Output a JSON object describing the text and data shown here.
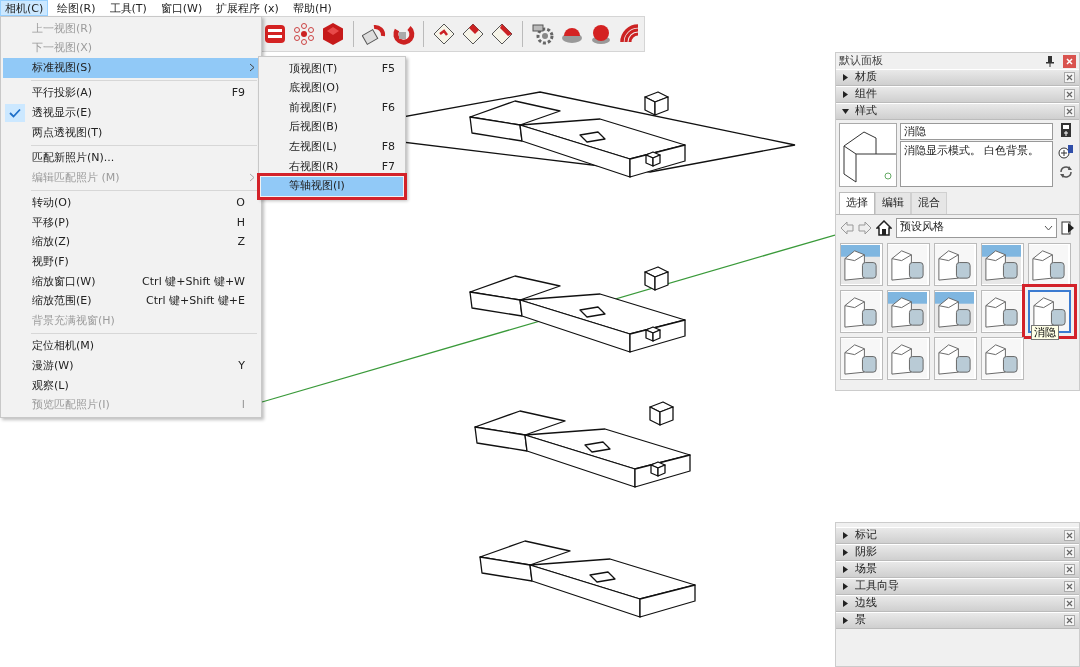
{
  "menubar": [
    {
      "label": "相机(C)",
      "selected": true
    },
    {
      "label": "绘图(R)",
      "selected": false
    },
    {
      "label": "工具(T)",
      "selected": false
    },
    {
      "label": "窗口(W)",
      "selected": false
    },
    {
      "label": "扩展程序 (x)",
      "selected": false
    },
    {
      "label": "帮助(H)",
      "selected": false
    }
  ],
  "camera_menu": {
    "groups": [
      [
        {
          "label": "上一视图(R)",
          "disabled": true,
          "checked": false,
          "selected": false,
          "submenu": false
        },
        {
          "label": "下一视图(X)",
          "disabled": true,
          "checked": false,
          "selected": false,
          "submenu": false
        },
        {
          "label": "标准视图(S)",
          "disabled": false,
          "checked": false,
          "selected": true,
          "submenu": true
        }
      ],
      [
        {
          "label": "平行投影(A)",
          "shortcut": "F9",
          "disabled": false,
          "checked": false,
          "selected": false,
          "submenu": false
        },
        {
          "label": "透视显示(E)",
          "disabled": false,
          "checked": true,
          "selected": false,
          "submenu": false
        },
        {
          "label": "两点透视图(T)",
          "disabled": false,
          "checked": false,
          "selected": false,
          "submenu": false
        }
      ],
      [
        {
          "label": "匹配新照片(N)...",
          "disabled": false,
          "checked": false,
          "selected": false,
          "submenu": false
        },
        {
          "label": "编辑匹配照片 (M)",
          "disabled": true,
          "checked": false,
          "selected": false,
          "submenu": true
        }
      ],
      [
        {
          "label": "转动(O)",
          "shortcut": "O",
          "disabled": false,
          "checked": false,
          "selected": false,
          "submenu": false
        },
        {
          "label": "平移(P)",
          "shortcut": "H",
          "disabled": false,
          "checked": false,
          "selected": false,
          "submenu": false
        },
        {
          "label": "缩放(Z)",
          "shortcut": "Z",
          "disabled": false,
          "checked": false,
          "selected": false,
          "submenu": false
        },
        {
          "label": "视野(F)",
          "disabled": false,
          "checked": false,
          "selected": false,
          "submenu": false
        },
        {
          "label": "缩放窗口(W)",
          "shortcut": "Ctrl 键+Shift 键+W",
          "disabled": false,
          "checked": false,
          "selected": false,
          "submenu": false
        },
        {
          "label": "缩放范围(E)",
          "shortcut": "Ctrl 键+Shift 键+E",
          "disabled": false,
          "checked": false,
          "selected": false,
          "submenu": false
        },
        {
          "label": "背景充满视窗(H)",
          "disabled": true,
          "checked": false,
          "selected": false,
          "submenu": false
        }
      ],
      [
        {
          "label": "定位相机(M)",
          "disabled": false,
          "checked": false,
          "selected": false,
          "submenu": false
        },
        {
          "label": "漫游(W)",
          "shortcut": "Y",
          "disabled": false,
          "checked": false,
          "selected": false,
          "submenu": false
        },
        {
          "label": "观察(L)",
          "disabled": false,
          "checked": false,
          "selected": false,
          "submenu": false
        },
        {
          "label": "预览匹配照片(I)",
          "shortcut": "I",
          "disabled": true,
          "checked": false,
          "selected": false,
          "submenu": false
        }
      ]
    ]
  },
  "standard_views_menu": {
    "items": [
      {
        "label": "顶视图(T)",
        "shortcut": "F5",
        "selected": false,
        "annotated": false
      },
      {
        "label": "底视图(O)",
        "selected": false,
        "annotated": false
      },
      {
        "label": "前视图(F)",
        "shortcut": "F6",
        "selected": false,
        "annotated": false
      },
      {
        "label": "后视图(B)",
        "selected": false,
        "annotated": false
      },
      {
        "label": "左视图(L)",
        "shortcut": "F8",
        "selected": false,
        "annotated": false
      },
      {
        "label": "右视图(R)",
        "shortcut": "F7",
        "selected": false,
        "annotated": false
      },
      {
        "label": "等轴视图(I)",
        "selected": true,
        "annotated": true
      }
    ]
  },
  "tray": {
    "title": "默认面板",
    "sections": [
      {
        "label": "材质",
        "expanded": false
      },
      {
        "label": "组件",
        "expanded": false
      },
      {
        "label": "样式",
        "expanded": true
      }
    ],
    "styles": {
      "name": "消隐",
      "description": "消隐显示模式。 白色背景。",
      "tabs": [
        {
          "label": "选择",
          "selected": true
        },
        {
          "label": "编辑",
          "selected": false
        },
        {
          "label": "混合",
          "selected": false
        }
      ],
      "collection": "预设风格",
      "thumbnails": [
        {
          "sky": true,
          "selected": false,
          "annotated": false
        },
        {
          "sky": false,
          "selected": false,
          "annotated": false
        },
        {
          "sky": false,
          "selected": false,
          "annotated": false
        },
        {
          "sky": true,
          "selected": false,
          "annotated": false
        },
        {
          "sky": false,
          "selected": false,
          "annotated": false
        },
        {
          "sky": false,
          "selected": false,
          "annotated": false
        },
        {
          "sky": true,
          "selected": false,
          "annotated": false
        },
        {
          "sky": true,
          "selected": false,
          "annotated": false
        },
        {
          "sky": false,
          "selected": false,
          "annotated": false
        },
        {
          "sky": false,
          "selected": true,
          "annotated": true,
          "tooltip": "消隐"
        },
        {
          "sky": false,
          "selected": false,
          "annotated": false
        },
        {
          "sky": false,
          "selected": false,
          "annotated": false
        },
        {
          "sky": false,
          "selected": false,
          "annotated": false
        },
        {
          "sky": false,
          "selected": false,
          "annotated": false
        }
      ]
    }
  },
  "lower_tray": {
    "sections": [
      {
        "label": "标记",
        "expanded": false
      },
      {
        "label": "阴影",
        "expanded": false
      },
      {
        "label": "场景",
        "expanded": false
      },
      {
        "label": "工具向导",
        "expanded": false
      },
      {
        "label": "边线",
        "expanded": false
      },
      {
        "label": "景",
        "expanded": false
      }
    ]
  }
}
